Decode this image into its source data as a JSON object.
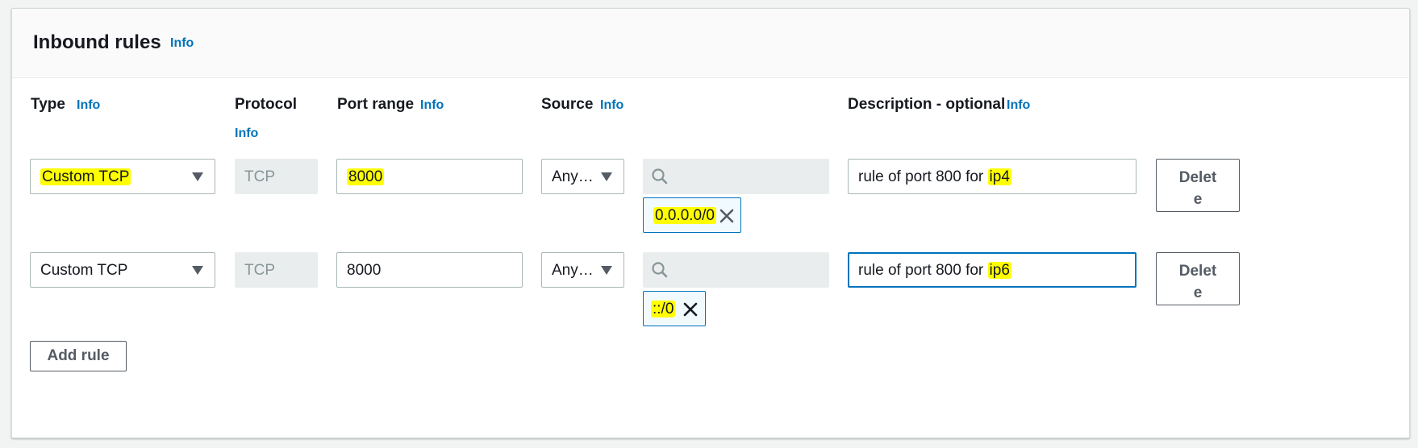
{
  "section": {
    "title": "Inbound rules",
    "info": "Info"
  },
  "columns": {
    "type": "Type",
    "type_info": "Info",
    "protocol": "Protocol",
    "protocol_info": "Info",
    "port_range": "Port range",
    "port_range_info": "Info",
    "source": "Source",
    "source_info": "Info",
    "description": "Description - optional",
    "description_info": "Info"
  },
  "rules": [
    {
      "type": "Custom TCP",
      "protocol": "TCP",
      "port_range": "8000",
      "source_select": "Any…",
      "source_token": "0.0.0.0/0",
      "description_prefix": "rule of port 800 for ",
      "description_suffix": "ip4",
      "delete_label_1": "Delet",
      "delete_label_2": "e"
    },
    {
      "type": "Custom TCP",
      "protocol": "TCP",
      "port_range": "8000",
      "source_select": "Any…",
      "source_token": "::/0",
      "description_prefix": "rule of port 800 for ",
      "description_suffix": "ip6",
      "delete_label_1": "Delet",
      "delete_label_2": "e"
    }
  ],
  "add_rule_label": "Add rule",
  "icons": {
    "caret": "caret-down-icon",
    "search": "search-icon",
    "remove": "close-icon"
  },
  "colors": {
    "link": "#0073bb",
    "highlight": "#ffff00",
    "token_border": "#0073bb",
    "focus_border": "#0073bb"
  }
}
